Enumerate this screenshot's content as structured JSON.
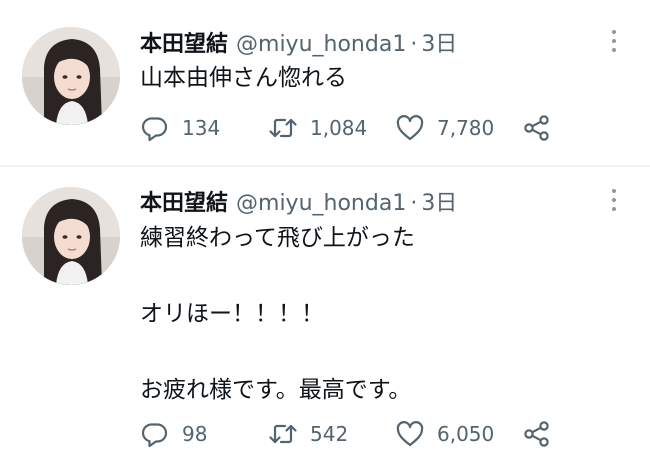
{
  "colors": {
    "text": "#0f1419",
    "secondary": "#536471",
    "divider": "#eff3f4"
  },
  "icons": {
    "reply": "reply-icon",
    "retweet": "retweet-icon",
    "like": "heart-icon",
    "share": "share-icon",
    "more": "more-options-icon"
  },
  "tweets": [
    {
      "name": "本田望結",
      "handle": "@miyu_honda1",
      "separator": "·",
      "time": "3日",
      "text": "山本由伸さん惚れる",
      "replies": "134",
      "retweets": "1,084",
      "likes": "7,780"
    },
    {
      "name": "本田望結",
      "handle": "@miyu_honda1",
      "separator": "·",
      "time": "3日",
      "text": "練習終わって飛び上がった\n\nオリほー！！！！\n\nお疲れ様です。最高です。",
      "replies": "98",
      "retweets": "542",
      "likes": "6,050"
    }
  ]
}
